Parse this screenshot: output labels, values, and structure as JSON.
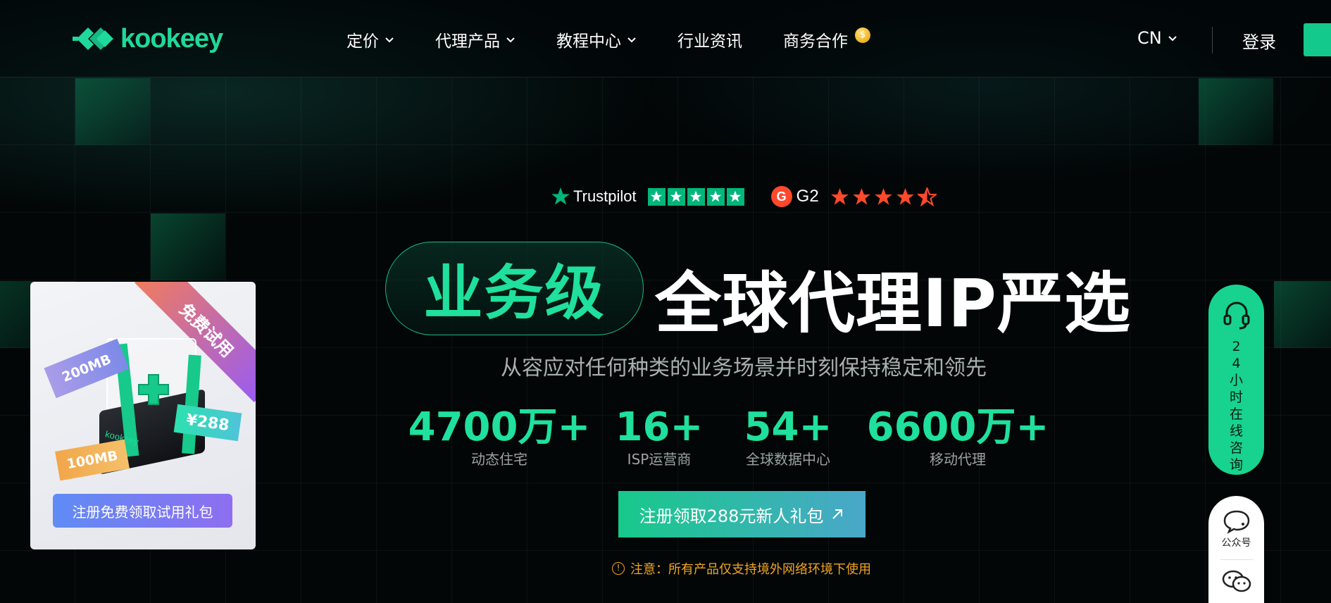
{
  "brand": {
    "name": "kookeey",
    "color": "#1fd99a"
  },
  "nav": {
    "items": [
      {
        "label": "定价",
        "dropdown": true
      },
      {
        "label": "代理产品",
        "dropdown": true
      },
      {
        "label": "教程中心",
        "dropdown": true
      },
      {
        "label": "行业资讯",
        "dropdown": false
      },
      {
        "label": "商务合作",
        "dropdown": false,
        "badge": "coin-icon"
      }
    ],
    "coin_symbol": "$",
    "lang": "CN",
    "login": "登录"
  },
  "ratings": {
    "trustpilot": "Trustpilot",
    "g2": "G2"
  },
  "hero": {
    "pill": "业务级",
    "headline": "全球代理IP严选",
    "subtitle": "从容应对任何种类的业务场景并时刻保持稳定和领先",
    "stats": [
      {
        "value": "4700万+",
        "label": "动态住宅"
      },
      {
        "value": "16+",
        "label": "ISP运营商"
      },
      {
        "value": "54+",
        "label": "全球数据中心"
      },
      {
        "value": "6600万+",
        "label": "移动代理"
      }
    ],
    "cta": "注册领取288元新人礼包",
    "notice": "注意：所有产品仅支持境外网络环境下使用"
  },
  "promo": {
    "ribbon": "免费试用",
    "tag_200": "200MB",
    "tag_100": "100MB",
    "tag_288": "¥288",
    "box_logo": "kookeey",
    "button": "注册免费领取试用礼包"
  },
  "side": {
    "consult_hours": "24",
    "consult_text": "小时在线咨询",
    "wechat_official": "公众号"
  },
  "colors": {
    "accent": "#1fe09c",
    "trustpilot": "#00b67a",
    "g2": "#ff492c",
    "notice": "#f0a51e"
  }
}
